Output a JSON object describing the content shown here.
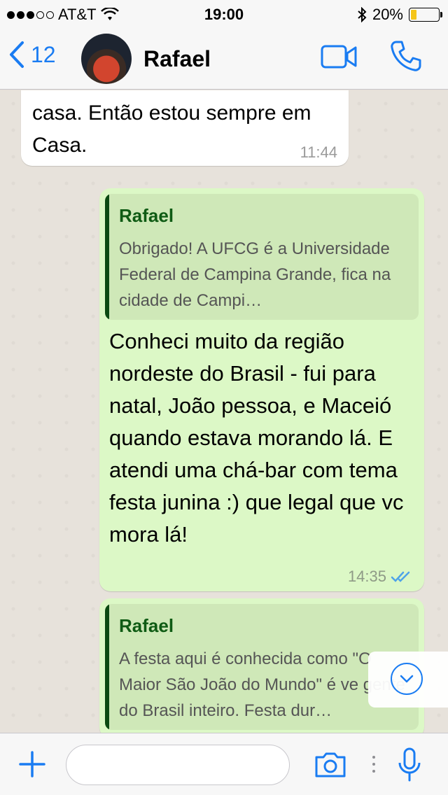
{
  "status_bar": {
    "carrier": "AT&T",
    "time": "19:00",
    "battery_percent": "20%",
    "battery_level": 0.2,
    "signal_dots_filled": 3,
    "signal_dots_total": 5
  },
  "header": {
    "back_count": "12",
    "contact_name": "Rafael",
    "accent_color": "#1a7cf2"
  },
  "messages": [
    {
      "direction": "incoming",
      "text": "casa. Então estou sempre em Casa.",
      "time": "11:44"
    },
    {
      "direction": "outgoing",
      "quote_author": "Rafael",
      "quote_text": "Obrigado! A UFCG é a Universidade Federal de Campina Grande, fica na cidade de Campi…",
      "text": "Conheci muito da região nordeste do Brasil - fui para natal, João pessoa, e Maceió quando estava morando lá. E atendi uma chá-bar com tema festa junina :) que legal que vc mora lá!",
      "time": "14:35",
      "status": "read"
    },
    {
      "direction": "outgoing",
      "quote_author": "Rafael",
      "quote_text": "A festa aqui é conhecida como \"O Maior São João do Mundo\" é ve gente do Brasil inteiro. Festa dur…"
    }
  ],
  "icons": {
    "back": "chevron-left-icon",
    "video": "video-camera-icon",
    "phone": "phone-icon",
    "scroll_down": "chevron-down-icon",
    "add": "plus-icon",
    "camera": "camera-icon",
    "mic": "microphone-icon",
    "read_receipt": "double-check-icon"
  }
}
